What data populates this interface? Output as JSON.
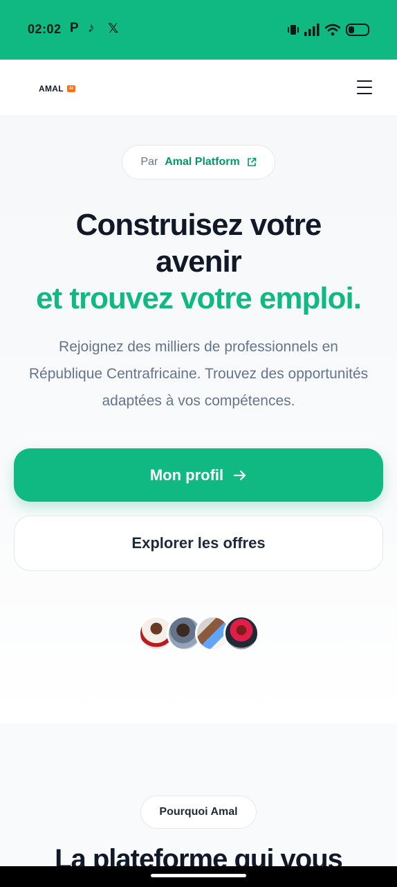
{
  "status_bar": {
    "time": "02:02",
    "app_icons": [
      "p-app-icon",
      "tiktok-icon",
      "x-icon"
    ],
    "app_glyphs": [
      "P",
      "♪",
      "𝕏"
    ],
    "battery_level": 0.3
  },
  "header": {
    "logo_text": "AMAL",
    "logo_badge": "AI",
    "menu_icon": "hamburger-menu-icon"
  },
  "hero": {
    "badge_prefix": "Par",
    "badge_link": "Amal Platform",
    "title_line1": "Construisez votre",
    "title_line2": "avenir",
    "title_highlight": "et trouvez votre emploi.",
    "subtitle": "Rejoignez des milliers de professionnels en République Centrafricaine. Trouvez des opportunités adaptées à vos compétences.",
    "primary_button": "Mon profil",
    "primary_button_icon": "arrow-right-icon",
    "secondary_button": "Explorer les offres"
  },
  "section2": {
    "badge": "Pourquoi Amal",
    "title_partial": "La plateforme qui vous"
  },
  "colors": {
    "brand_green": "#10b981",
    "dark_text": "#111827",
    "muted_text": "#64748b",
    "logo_badge": "#f97316"
  }
}
